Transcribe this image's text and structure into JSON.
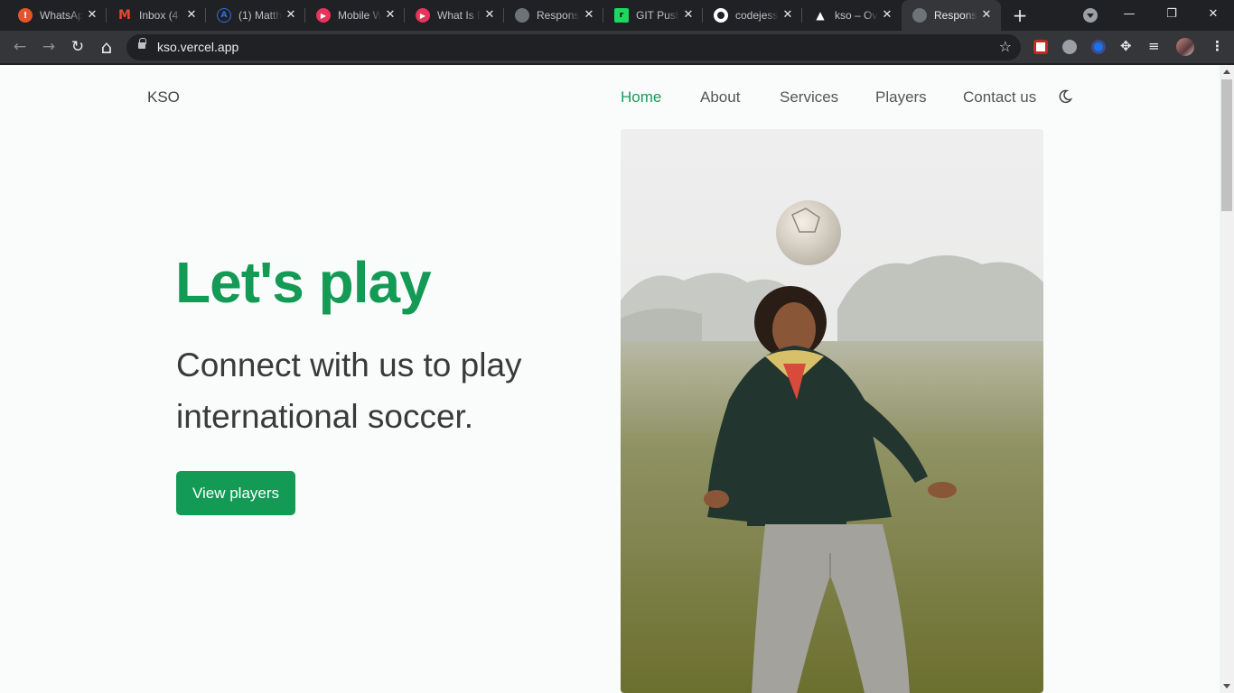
{
  "browser": {
    "tabs": [
      {
        "title": "WhatsApp",
        "icon": "whatsapp-alert-icon",
        "color": "#e8542a"
      },
      {
        "title": "Inbox (4",
        "icon": "gmail-icon",
        "color": "#ea4335"
      },
      {
        "title": "(1) Matth",
        "icon": "angular-icon",
        "color": "#2f6fe0"
      },
      {
        "title": "Mobile W",
        "icon": "video-play-icon",
        "color": "#e8345d"
      },
      {
        "title": "What Is R",
        "icon": "video-play-icon",
        "color": "#e8345d"
      },
      {
        "title": "Respons",
        "icon": "globe-icon",
        "color": "#6e7378"
      },
      {
        "title": "GIT Push",
        "icon": "devto-icon",
        "color": "#1ed760"
      },
      {
        "title": "codejess",
        "icon": "github-icon",
        "color": "#ffffff"
      },
      {
        "title": "kso – Ov",
        "icon": "vercel-icon",
        "color": "#ffffff"
      },
      {
        "title": "Respons",
        "icon": "globe-icon",
        "color": "#6e7378",
        "active": true
      }
    ],
    "new_tab": "+",
    "window_controls": {
      "minimize": "—",
      "restore": "❐",
      "close": "✕"
    },
    "nav": {
      "back": "←",
      "forward": "→",
      "reload": "↻",
      "home": "⌂"
    },
    "url": "kso.vercel.app",
    "bookmark_icon": "☆",
    "menu_icon": "⋮",
    "puzzle_icon": "✥",
    "media_icon": "≡"
  },
  "site": {
    "logo": "KSO",
    "nav": [
      {
        "label": "Home",
        "active": true
      },
      {
        "label": "About"
      },
      {
        "label": "Services"
      },
      {
        "label": "Players"
      },
      {
        "label": "Contact us"
      }
    ],
    "theme_toggle_icon": "moon-icon",
    "hero": {
      "title": "Let's play",
      "subtitle": "Connect with us to play international soccer.",
      "cta": "View players"
    },
    "colors": {
      "accent": "#139a55",
      "text": "#3a3a3a"
    }
  }
}
